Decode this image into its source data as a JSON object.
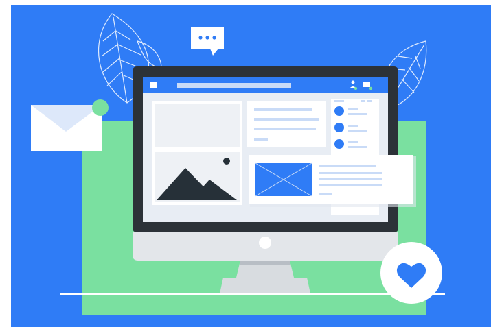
{
  "illustration": {
    "colors": {
      "background": "#2F7CF6",
      "green_panel": "#7AE0A0",
      "monitor_bezel": "#2C3238",
      "monitor_chin": "#E3E6EA",
      "stand": "#D8DCE0",
      "screen_blue": "#2F7CF6",
      "white": "#FFFFFF",
      "placeholder_gray": "#EEF1F5",
      "text_line_blue": "#C9DBF7",
      "mountain_dark": "#263038",
      "heart_blue": "#2F7CF6",
      "envelope_flap": "#DDE8FA",
      "notification_dot": "#7AE0A0"
    },
    "icons": [
      "envelope-icon",
      "chat-bubble-icon",
      "leaf-icon",
      "monitor-icon",
      "image-placeholder-icon",
      "user-icon",
      "message-icon",
      "heart-icon"
    ]
  }
}
